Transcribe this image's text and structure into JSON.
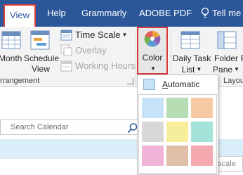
{
  "tabs": {
    "view": "View",
    "help": "Help",
    "grammarly": "Grammarly",
    "adobe": "ADOBE PDF",
    "tellme": "Tell me w"
  },
  "ribbon": {
    "month": "Month",
    "schedule_line1": "Schedule",
    "schedule_line2": "View",
    "time_scale": "Time Scale",
    "overlay": "Overlay",
    "working_hours": "Working Hours",
    "color": "Color",
    "daily_task_line1": "Daily Task",
    "daily_task_line2": "List",
    "folder_line1": "Folder",
    "folder_line2": "Pane",
    "arrangement_group": "rrangement",
    "layout_group": "Layou"
  },
  "search": {
    "placeholder": "Search Calendar"
  },
  "time_scale_field": "e scale",
  "color_menu": {
    "automatic_first": "A",
    "automatic_rest": "utomatic",
    "swatches": [
      "#c6e2f7",
      "#b6ddb4",
      "#f7c9a3",
      "#d8d8d8",
      "#f7ee9b",
      "#a4e4d8",
      "#f1b3d8",
      "#dfbfa8",
      "#f4aab0"
    ]
  }
}
